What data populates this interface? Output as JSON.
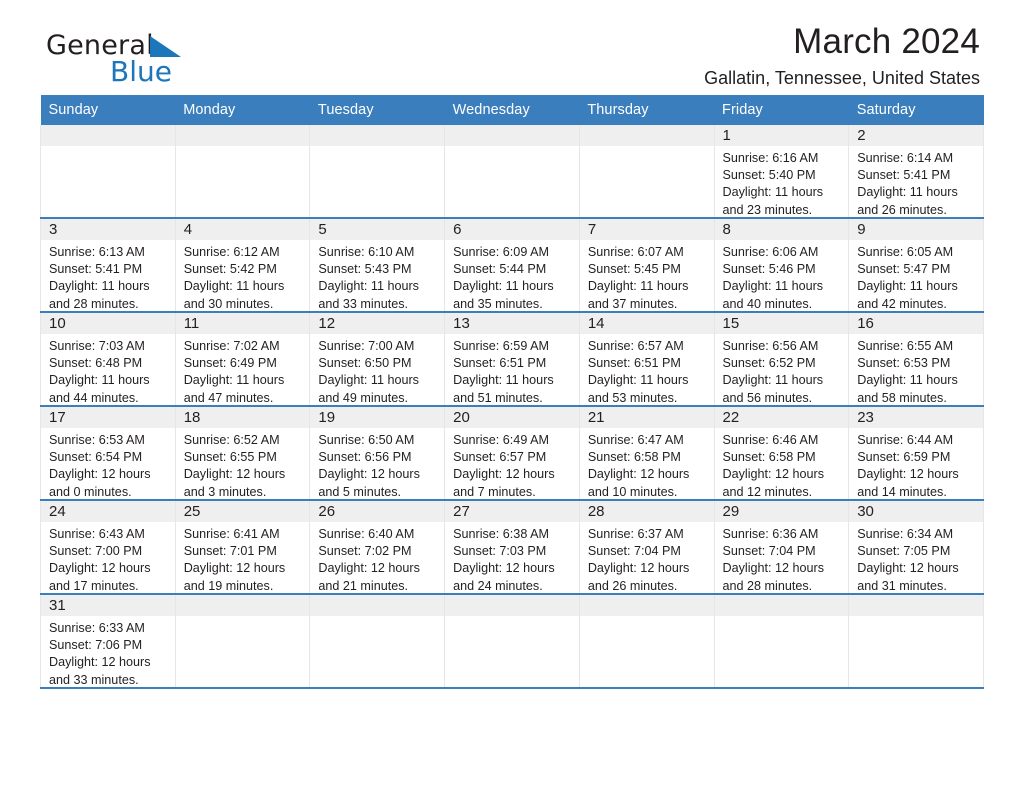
{
  "brand": {
    "name_part1": "General",
    "name_part2": "Blue",
    "accent_color": "#1b76bc"
  },
  "header": {
    "title": "March 2024",
    "subtitle": "Gallatin, Tennessee, United States"
  },
  "theme": {
    "header_blue": "#3a7ebd",
    "daynum_band": "#efefef",
    "grid_line": "#e6e6e6",
    "text": "#231f20"
  },
  "weekday_headers": [
    "Sunday",
    "Monday",
    "Tuesday",
    "Wednesday",
    "Thursday",
    "Friday",
    "Saturday"
  ],
  "weeks": [
    [
      {
        "day": "",
        "blank": true
      },
      {
        "day": "",
        "blank": true
      },
      {
        "day": "",
        "blank": true
      },
      {
        "day": "",
        "blank": true
      },
      {
        "day": "",
        "blank": true
      },
      {
        "day": "1",
        "sunrise": "Sunrise: 6:16 AM",
        "sunset": "Sunset: 5:40 PM",
        "daylight_line1": "Daylight: 11 hours",
        "daylight_line2": "and 23 minutes."
      },
      {
        "day": "2",
        "sunrise": "Sunrise: 6:14 AM",
        "sunset": "Sunset: 5:41 PM",
        "daylight_line1": "Daylight: 11 hours",
        "daylight_line2": "and 26 minutes."
      }
    ],
    [
      {
        "day": "3",
        "sunrise": "Sunrise: 6:13 AM",
        "sunset": "Sunset: 5:41 PM",
        "daylight_line1": "Daylight: 11 hours",
        "daylight_line2": "and 28 minutes."
      },
      {
        "day": "4",
        "sunrise": "Sunrise: 6:12 AM",
        "sunset": "Sunset: 5:42 PM",
        "daylight_line1": "Daylight: 11 hours",
        "daylight_line2": "and 30 minutes."
      },
      {
        "day": "5",
        "sunrise": "Sunrise: 6:10 AM",
        "sunset": "Sunset: 5:43 PM",
        "daylight_line1": "Daylight: 11 hours",
        "daylight_line2": "and 33 minutes."
      },
      {
        "day": "6",
        "sunrise": "Sunrise: 6:09 AM",
        "sunset": "Sunset: 5:44 PM",
        "daylight_line1": "Daylight: 11 hours",
        "daylight_line2": "and 35 minutes."
      },
      {
        "day": "7",
        "sunrise": "Sunrise: 6:07 AM",
        "sunset": "Sunset: 5:45 PM",
        "daylight_line1": "Daylight: 11 hours",
        "daylight_line2": "and 37 minutes."
      },
      {
        "day": "8",
        "sunrise": "Sunrise: 6:06 AM",
        "sunset": "Sunset: 5:46 PM",
        "daylight_line1": "Daylight: 11 hours",
        "daylight_line2": "and 40 minutes."
      },
      {
        "day": "9",
        "sunrise": "Sunrise: 6:05 AM",
        "sunset": "Sunset: 5:47 PM",
        "daylight_line1": "Daylight: 11 hours",
        "daylight_line2": "and 42 minutes."
      }
    ],
    [
      {
        "day": "10",
        "sunrise": "Sunrise: 7:03 AM",
        "sunset": "Sunset: 6:48 PM",
        "daylight_line1": "Daylight: 11 hours",
        "daylight_line2": "and 44 minutes."
      },
      {
        "day": "11",
        "sunrise": "Sunrise: 7:02 AM",
        "sunset": "Sunset: 6:49 PM",
        "daylight_line1": "Daylight: 11 hours",
        "daylight_line2": "and 47 minutes."
      },
      {
        "day": "12",
        "sunrise": "Sunrise: 7:00 AM",
        "sunset": "Sunset: 6:50 PM",
        "daylight_line1": "Daylight: 11 hours",
        "daylight_line2": "and 49 minutes."
      },
      {
        "day": "13",
        "sunrise": "Sunrise: 6:59 AM",
        "sunset": "Sunset: 6:51 PM",
        "daylight_line1": "Daylight: 11 hours",
        "daylight_line2": "and 51 minutes."
      },
      {
        "day": "14",
        "sunrise": "Sunrise: 6:57 AM",
        "sunset": "Sunset: 6:51 PM",
        "daylight_line1": "Daylight: 11 hours",
        "daylight_line2": "and 53 minutes."
      },
      {
        "day": "15",
        "sunrise": "Sunrise: 6:56 AM",
        "sunset": "Sunset: 6:52 PM",
        "daylight_line1": "Daylight: 11 hours",
        "daylight_line2": "and 56 minutes."
      },
      {
        "day": "16",
        "sunrise": "Sunrise: 6:55 AM",
        "sunset": "Sunset: 6:53 PM",
        "daylight_line1": "Daylight: 11 hours",
        "daylight_line2": "and 58 minutes."
      }
    ],
    [
      {
        "day": "17",
        "sunrise": "Sunrise: 6:53 AM",
        "sunset": "Sunset: 6:54 PM",
        "daylight_line1": "Daylight: 12 hours",
        "daylight_line2": "and 0 minutes."
      },
      {
        "day": "18",
        "sunrise": "Sunrise: 6:52 AM",
        "sunset": "Sunset: 6:55 PM",
        "daylight_line1": "Daylight: 12 hours",
        "daylight_line2": "and 3 minutes."
      },
      {
        "day": "19",
        "sunrise": "Sunrise: 6:50 AM",
        "sunset": "Sunset: 6:56 PM",
        "daylight_line1": "Daylight: 12 hours",
        "daylight_line2": "and 5 minutes."
      },
      {
        "day": "20",
        "sunrise": "Sunrise: 6:49 AM",
        "sunset": "Sunset: 6:57 PM",
        "daylight_line1": "Daylight: 12 hours",
        "daylight_line2": "and 7 minutes."
      },
      {
        "day": "21",
        "sunrise": "Sunrise: 6:47 AM",
        "sunset": "Sunset: 6:58 PM",
        "daylight_line1": "Daylight: 12 hours",
        "daylight_line2": "and 10 minutes."
      },
      {
        "day": "22",
        "sunrise": "Sunrise: 6:46 AM",
        "sunset": "Sunset: 6:58 PM",
        "daylight_line1": "Daylight: 12 hours",
        "daylight_line2": "and 12 minutes."
      },
      {
        "day": "23",
        "sunrise": "Sunrise: 6:44 AM",
        "sunset": "Sunset: 6:59 PM",
        "daylight_line1": "Daylight: 12 hours",
        "daylight_line2": "and 14 minutes."
      }
    ],
    [
      {
        "day": "24",
        "sunrise": "Sunrise: 6:43 AM",
        "sunset": "Sunset: 7:00 PM",
        "daylight_line1": "Daylight: 12 hours",
        "daylight_line2": "and 17 minutes."
      },
      {
        "day": "25",
        "sunrise": "Sunrise: 6:41 AM",
        "sunset": "Sunset: 7:01 PM",
        "daylight_line1": "Daylight: 12 hours",
        "daylight_line2": "and 19 minutes."
      },
      {
        "day": "26",
        "sunrise": "Sunrise: 6:40 AM",
        "sunset": "Sunset: 7:02 PM",
        "daylight_line1": "Daylight: 12 hours",
        "daylight_line2": "and 21 minutes."
      },
      {
        "day": "27",
        "sunrise": "Sunrise: 6:38 AM",
        "sunset": "Sunset: 7:03 PM",
        "daylight_line1": "Daylight: 12 hours",
        "daylight_line2": "and 24 minutes."
      },
      {
        "day": "28",
        "sunrise": "Sunrise: 6:37 AM",
        "sunset": "Sunset: 7:04 PM",
        "daylight_line1": "Daylight: 12 hours",
        "daylight_line2": "and 26 minutes."
      },
      {
        "day": "29",
        "sunrise": "Sunrise: 6:36 AM",
        "sunset": "Sunset: 7:04 PM",
        "daylight_line1": "Daylight: 12 hours",
        "daylight_line2": "and 28 minutes."
      },
      {
        "day": "30",
        "sunrise": "Sunrise: 6:34 AM",
        "sunset": "Sunset: 7:05 PM",
        "daylight_line1": "Daylight: 12 hours",
        "daylight_line2": "and 31 minutes."
      }
    ],
    [
      {
        "day": "31",
        "sunrise": "Sunrise: 6:33 AM",
        "sunset": "Sunset: 7:06 PM",
        "daylight_line1": "Daylight: 12 hours",
        "daylight_line2": "and 33 minutes."
      },
      {
        "day": "",
        "blank": true
      },
      {
        "day": "",
        "blank": true
      },
      {
        "day": "",
        "blank": true
      },
      {
        "day": "",
        "blank": true
      },
      {
        "day": "",
        "blank": true
      },
      {
        "day": "",
        "blank": true
      }
    ]
  ]
}
